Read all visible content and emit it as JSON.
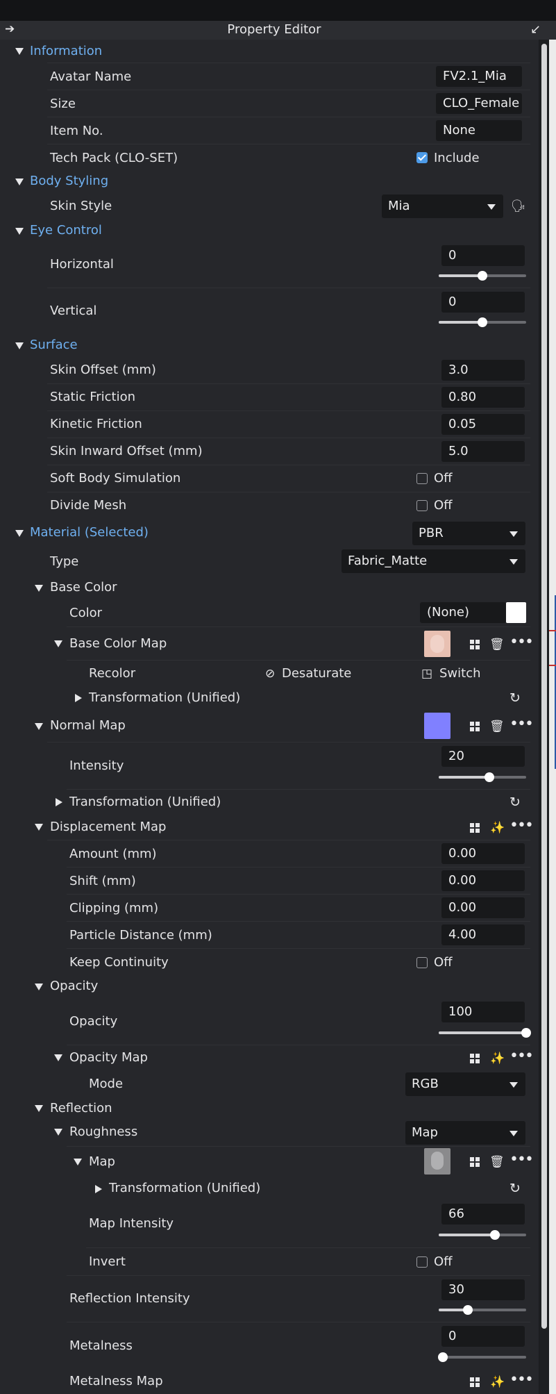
{
  "window": {
    "title": "Property Editor",
    "pin_icon": "arrow-right-icon",
    "undock_icon": "arrow-down-left-icon"
  },
  "information": {
    "header": "Information",
    "avatar_name_label": "Avatar Name",
    "avatar_name_value": "FV2.1_Mia",
    "size_label": "Size",
    "size_value": "CLO_Female",
    "item_no_label": "Item No.",
    "item_no_value": "None",
    "tech_pack_label": "Tech Pack (CLO-SET)",
    "tech_pack_check_label": "Include",
    "tech_pack_checked": true
  },
  "body_styling": {
    "header": "Body Styling",
    "skin_style_label": "Skin Style",
    "skin_style_value": "Mia",
    "skin_icon": "head-profile-icon"
  },
  "eye_control": {
    "header": "Eye Control",
    "horizontal_label": "Horizontal",
    "horizontal_value": "0",
    "horizontal_level": 0.5,
    "vertical_label": "Vertical",
    "vertical_value": "0",
    "vertical_level": 0.5
  },
  "surface": {
    "header": "Surface",
    "skin_offset_label": "Skin Offset (mm)",
    "skin_offset_value": "3.0",
    "static_friction_label": "Static Friction",
    "static_friction_value": "0.80",
    "kinetic_friction_label": "Kinetic Friction",
    "kinetic_friction_value": "0.05",
    "skin_inward_label": "Skin Inward Offset (mm)",
    "skin_inward_value": "5.0",
    "soft_body_label": "Soft Body Simulation",
    "soft_body_check": "Off",
    "divide_mesh_label": "Divide Mesh",
    "divide_mesh_check": "Off"
  },
  "material": {
    "header": "Material (Selected)",
    "shader_value": "PBR",
    "type_label": "Type",
    "type_value": "Fabric_Matte",
    "base_color": {
      "header": "Base Color",
      "color_label": "Color",
      "color_value": "(None)",
      "swatch_color": "#ffffff",
      "map_header": "Base Color Map",
      "recolor_label": "Recolor",
      "desaturate_label": "Desaturate",
      "switch_label": "Switch",
      "transformation_label": "Transformation (Unified)"
    },
    "normal_map": {
      "header": "Normal Map",
      "swatch_color": "#8080ff",
      "intensity_label": "Intensity",
      "intensity_value": "20",
      "intensity_level": 0.58,
      "transformation_label": "Transformation (Unified)"
    },
    "displacement_map": {
      "header": "Displacement Map",
      "amount_label": "Amount (mm)",
      "amount_value": "0.00",
      "shift_label": "Shift (mm)",
      "shift_value": "0.00",
      "clipping_label": "Clipping (mm)",
      "clipping_value": "0.00",
      "particle_label": "Particle Distance (mm)",
      "particle_value": "4.00",
      "keep_label": "Keep Continuity",
      "keep_check": "Off"
    },
    "opacity": {
      "header": "Opacity",
      "opacity_label": "Opacity",
      "opacity_value": "100",
      "opacity_level": 1.0,
      "map_header": "Opacity Map",
      "mode_label": "Mode",
      "mode_value": "RGB"
    },
    "reflection": {
      "header": "Reflection",
      "roughness_label": "Roughness",
      "roughness_value": "Map",
      "map_label": "Map",
      "transformation_label": "Transformation (Unified)",
      "map_intensity_label": "Map Intensity",
      "map_intensity_value": "66",
      "map_intensity_level": 0.64,
      "invert_label": "Invert",
      "invert_check": "Off",
      "reflection_intensity_label": "Reflection Intensity",
      "reflection_intensity_value": "30",
      "reflection_intensity_level": 0.33,
      "metalness_label": "Metalness",
      "metalness_value": "0",
      "metalness_level": 0.05,
      "metalness_map_label": "Metalness Map"
    }
  },
  "icons": {
    "grid": "grid-icon",
    "delete": "trash-icon",
    "more": "more-dots-icon",
    "reset": "refresh-icon",
    "magic": "sparkle-icon"
  }
}
